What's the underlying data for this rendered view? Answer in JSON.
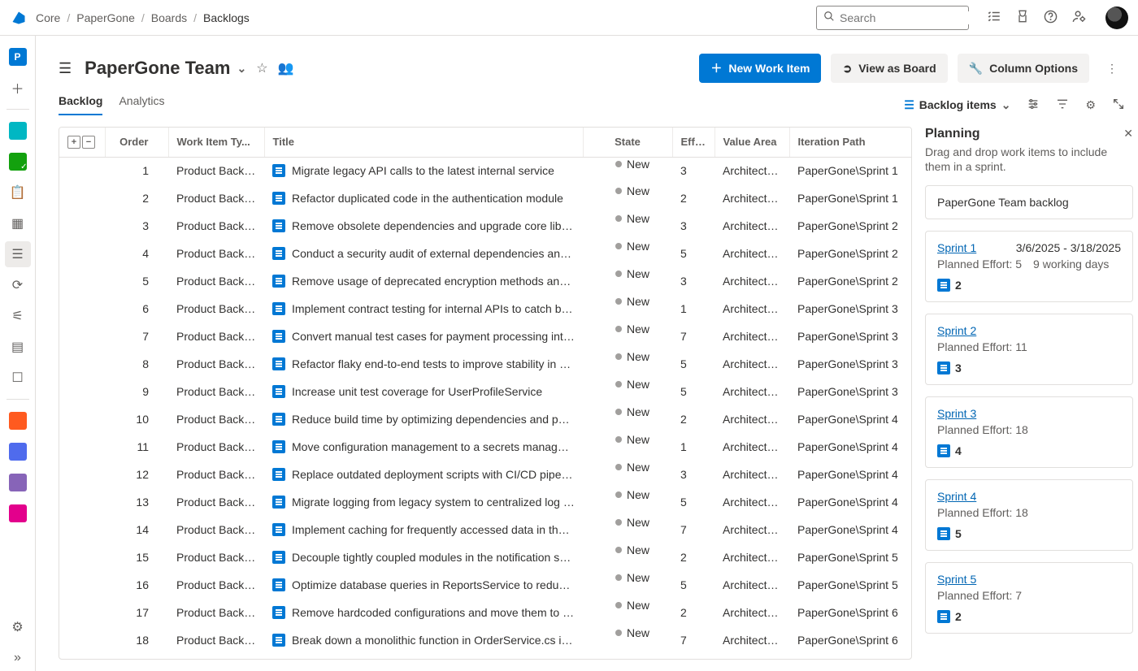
{
  "breadcrumbs": {
    "items": [
      "Core",
      "PaperGone",
      "Boards",
      "Backlogs"
    ]
  },
  "search": {
    "placeholder": "Search"
  },
  "sidebar": {
    "project_letter": "P"
  },
  "header": {
    "title": "PaperGone Team",
    "new_work_item": "New Work Item",
    "view_as_board": "View as Board",
    "column_options": "Column Options"
  },
  "tabs": {
    "items": [
      "Backlog",
      "Analytics"
    ],
    "active": 0,
    "view_selector": "Backlog items"
  },
  "columns": {
    "order": "Order",
    "work_item_type": "Work Item Ty...",
    "title": "Title",
    "state": "State",
    "effort": "Effort",
    "value_area": "Value Area",
    "iteration_path": "Iteration Path"
  },
  "rows": [
    {
      "order": "1",
      "type": "Product Backl...",
      "title": "Migrate legacy API calls to the latest internal service",
      "state": "New",
      "effort": "3",
      "area": "Architectural",
      "path": "PaperGone\\Sprint 1"
    },
    {
      "order": "2",
      "type": "Product Backl...",
      "title": "Refactor duplicated code in the authentication module",
      "state": "New",
      "effort": "2",
      "area": "Architectural",
      "path": "PaperGone\\Sprint 1"
    },
    {
      "order": "3",
      "type": "Product Backl...",
      "title": "Remove obsolete dependencies and upgrade core librari...",
      "state": "New",
      "effort": "3",
      "area": "Architectural",
      "path": "PaperGone\\Sprint 2"
    },
    {
      "order": "4",
      "type": "Product Backl...",
      "title": "Conduct a security audit of external dependencies and u...",
      "state": "New",
      "effort": "5",
      "area": "Architectural",
      "path": "PaperGone\\Sprint 2"
    },
    {
      "order": "5",
      "type": "Product Backl...",
      "title": "Remove usage of deprecated encryption methods and u...",
      "state": "New",
      "effort": "3",
      "area": "Architectural",
      "path": "PaperGone\\Sprint 2"
    },
    {
      "order": "6",
      "type": "Product Backl...",
      "title": "Implement contract testing for internal APIs to catch bre...",
      "state": "New",
      "effort": "1",
      "area": "Architectural",
      "path": "PaperGone\\Sprint 3"
    },
    {
      "order": "7",
      "type": "Product Backl...",
      "title": "Convert manual test cases for payment processing into ...",
      "state": "New",
      "effort": "7",
      "area": "Architectural",
      "path": "PaperGone\\Sprint 3"
    },
    {
      "order": "8",
      "type": "Product Backl...",
      "title": "Refactor flaky end-to-end tests to improve stability in CI...",
      "state": "New",
      "effort": "5",
      "area": "Architectural",
      "path": "PaperGone\\Sprint 3"
    },
    {
      "order": "9",
      "type": "Product Backl...",
      "title": "Increase unit test coverage for UserProfileService",
      "state": "New",
      "effort": "5",
      "area": "Architectural",
      "path": "PaperGone\\Sprint 3"
    },
    {
      "order": "10",
      "type": "Product Backl...",
      "title": "Reduce build time by optimizing dependencies and paral...",
      "state": "New",
      "effort": "2",
      "area": "Architectural",
      "path": "PaperGone\\Sprint 4"
    },
    {
      "order": "11",
      "type": "Product Backl...",
      "title": "Move configuration management to a secrets manager i...",
      "state": "New",
      "effort": "1",
      "area": "Architectural",
      "path": "PaperGone\\Sprint 4"
    },
    {
      "order": "12",
      "type": "Product Backl...",
      "title": "Replace outdated deployment scripts with CI/CD pipelin...",
      "state": "New",
      "effort": "3",
      "area": "Architectural",
      "path": "PaperGone\\Sprint 4"
    },
    {
      "order": "13",
      "type": "Product Backl...",
      "title": "Migrate logging from legacy system to centralized log a...",
      "state": "New",
      "effort": "5",
      "area": "Architectural",
      "path": "PaperGone\\Sprint 4"
    },
    {
      "order": "14",
      "type": "Product Backl...",
      "title": "Implement caching for frequently accessed data in the d...",
      "state": "New",
      "effort": "7",
      "area": "Architectural",
      "path": "PaperGone\\Sprint 4"
    },
    {
      "order": "15",
      "type": "Product Backl...",
      "title": "Decouple tightly coupled modules in the notification sys...",
      "state": "New",
      "effort": "2",
      "area": "Architectural",
      "path": "PaperGone\\Sprint 5"
    },
    {
      "order": "16",
      "type": "Product Backl...",
      "title": "Optimize database queries in ReportsService to reduce l...",
      "state": "New",
      "effort": "5",
      "area": "Architectural",
      "path": "PaperGone\\Sprint 5"
    },
    {
      "order": "17",
      "type": "Product Backl...",
      "title": "Remove hardcoded configurations and move them to en...",
      "state": "New",
      "effort": "2",
      "area": "Architectural",
      "path": "PaperGone\\Sprint 6"
    },
    {
      "order": "18",
      "type": "Product Backl...",
      "title": "Break down a monolithic function in OrderService.cs int...",
      "state": "New",
      "effort": "7",
      "area": "Architectural",
      "path": "PaperGone\\Sprint 6"
    }
  ],
  "planning": {
    "title": "Planning",
    "subtitle": "Drag and drop work items to include them in a sprint.",
    "backlog_card": "PaperGone Team backlog",
    "sprints": [
      {
        "name": "Sprint 1",
        "dates": "3/6/2025 - 3/18/2025",
        "effort": "Planned Effort: 5",
        "extra": "9 working days",
        "count": "2"
      },
      {
        "name": "Sprint 2",
        "dates": "",
        "effort": "Planned Effort: 11",
        "extra": "",
        "count": "3"
      },
      {
        "name": "Sprint 3",
        "dates": "",
        "effort": "Planned Effort: 18",
        "extra": "",
        "count": "4"
      },
      {
        "name": "Sprint 4",
        "dates": "",
        "effort": "Planned Effort: 18",
        "extra": "",
        "count": "5"
      },
      {
        "name": "Sprint 5",
        "dates": "",
        "effort": "Planned Effort: 7",
        "extra": "",
        "count": "2"
      }
    ]
  }
}
